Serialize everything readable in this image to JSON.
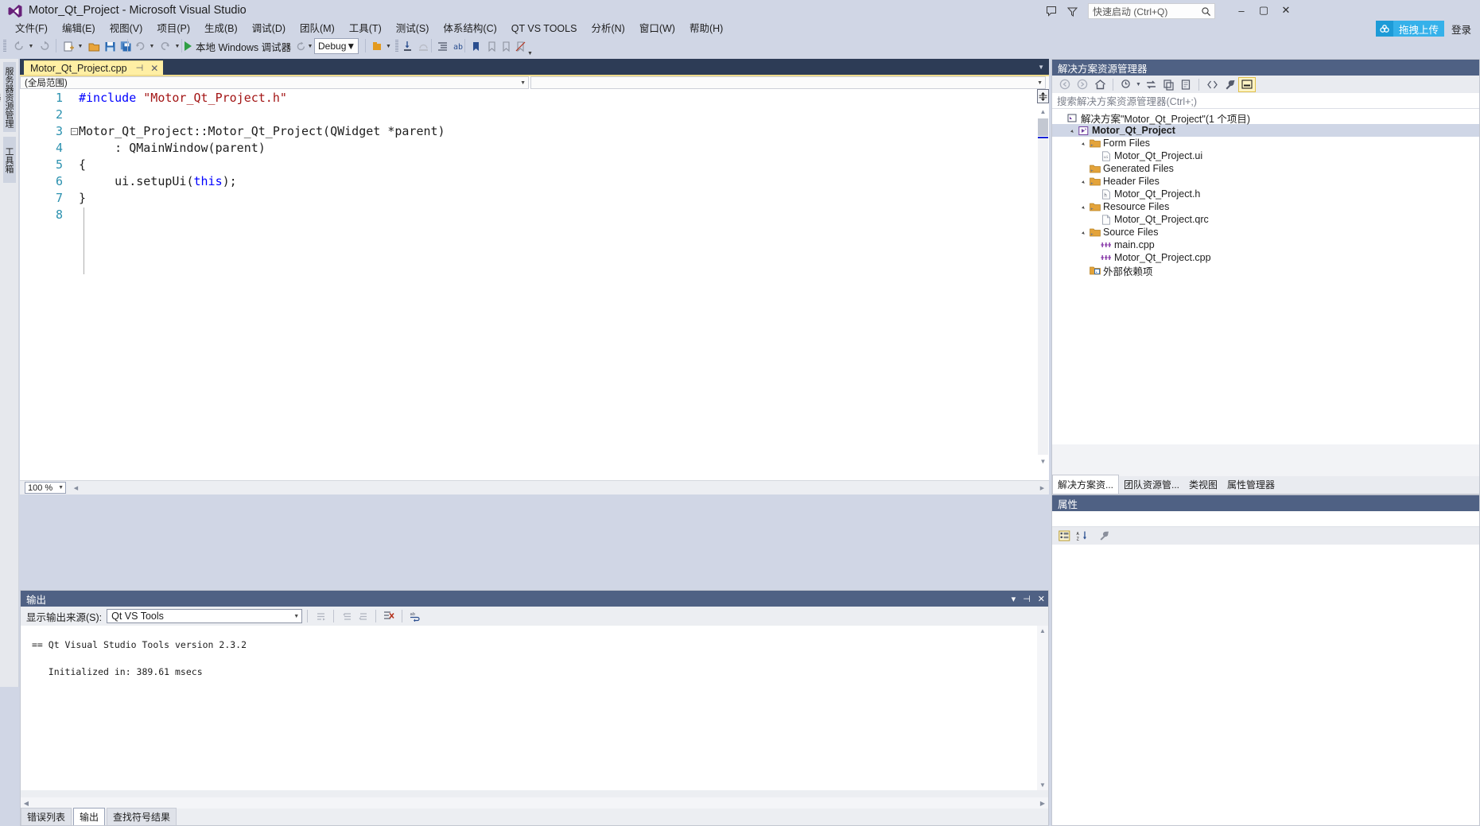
{
  "window": {
    "title": "Motor_Qt_Project - Microsoft Visual Studio",
    "logo_icon": "visual-studio-logo",
    "minimize": "–",
    "maximize": "▢",
    "close": "✕"
  },
  "titlebar": {
    "feedback_icon": "feedback-icon",
    "filter_icon": "filter-icon",
    "quick_launch_placeholder": "快速启动 (Ctrl+Q)",
    "search_icon": "search-icon"
  },
  "menu": {
    "items": [
      "文件(F)",
      "编辑(E)",
      "视图(V)",
      "项目(P)",
      "生成(B)",
      "调试(D)",
      "团队(M)",
      "工具(T)",
      "测试(S)",
      "体系结构(C)",
      "QT VS TOOLS",
      "分析(N)",
      "窗口(W)",
      "帮助(H)"
    ],
    "upload_label": "拖拽上传",
    "upload_icon": "cloud-upload-icon",
    "signin_label": "登录"
  },
  "toolbar": {
    "back_icon": "navigate-back-icon",
    "forward_icon": "navigate-forward-icon",
    "new_project_icon": "new-project-icon",
    "open_icon": "open-file-icon",
    "save_icon": "save-icon",
    "save_all_icon": "save-all-icon",
    "undo_icon": "undo-icon",
    "redo_icon": "redo-icon",
    "run_label": "本地 Windows 调试器",
    "run_icon": "play-icon",
    "refresh_icon": "restart-icon",
    "config_value": "Debug",
    "dropdown_icon": "chevron-down-icon"
  },
  "left_rail": {
    "tabs": [
      "服务器资源管理器",
      "工具箱"
    ]
  },
  "editor": {
    "tab_name": "Motor_Qt_Project.cpp",
    "pin_icon": "pin-icon",
    "close_icon": "close-icon",
    "tabstrip_dropdown_icon": "chevron-down-icon",
    "scope_dropdown": "(全局范围)",
    "member_dropdown": "",
    "zoom_level": "100 %",
    "map_icon": "scroll-map-icon",
    "code_lines": [
      {
        "n": "1",
        "fold": "",
        "parts": [
          {
            "t": "#include ",
            "c": "k-pre"
          },
          {
            "t": "\"Motor_Qt_Project.h\"",
            "c": "k-str"
          }
        ]
      },
      {
        "n": "2",
        "fold": "",
        "parts": [
          {
            "t": "",
            "c": ""
          }
        ]
      },
      {
        "n": "3",
        "fold": "−",
        "parts": [
          {
            "t": "Motor_Qt_Project::Motor_Qt_Project(QWidget *parent)",
            "c": ""
          }
        ]
      },
      {
        "n": "4",
        "fold": "",
        "parts": [
          {
            "t": "     : QMainWindow(parent)",
            "c": ""
          }
        ]
      },
      {
        "n": "5",
        "fold": "",
        "parts": [
          {
            "t": "{",
            "c": ""
          }
        ]
      },
      {
        "n": "6",
        "fold": "",
        "parts": [
          {
            "t": "     ui.setupUi(",
            "c": ""
          },
          {
            "t": "this",
            "c": "k-kw"
          },
          {
            "t": ");",
            "c": ""
          }
        ]
      },
      {
        "n": "7",
        "fold": "",
        "parts": [
          {
            "t": "}",
            "c": ""
          }
        ]
      },
      {
        "n": "8",
        "fold": "",
        "parts": [
          {
            "t": "",
            "c": ""
          }
        ]
      }
    ]
  },
  "output": {
    "title": "输出",
    "dropdown_icon": "chevron-down-icon",
    "pin_icon": "pin-icon",
    "close_icon": "close-icon",
    "source_label": "显示输出来源(S):",
    "source_value": "Qt VS Tools",
    "btn_goto_icon": "goto-message-icon",
    "btn_prev_icon": "previous-message-icon",
    "btn_next_icon": "next-message-icon",
    "btn_clear_icon": "clear-all-icon",
    "btn_wrap_icon": "toggle-word-wrap-icon",
    "lines": [
      "",
      "== Qt Visual Studio Tools version 2.3.2",
      "",
      "   Initialized in: 389.61 msecs"
    ],
    "bottom_tabs": [
      "错误列表",
      "输出",
      "查找符号结果"
    ],
    "bottom_tab_selected": "输出"
  },
  "solution_explorer": {
    "title": "解决方案资源管理器",
    "search_placeholder": "搜索解决方案资源管理器(Ctrl+;)",
    "toolbar_icons": [
      "back-icon",
      "forward-icon",
      "home-icon",
      "pending-changes-filter-icon",
      "sync-with-active-document-icon",
      "refresh-icon",
      "collapse-all-icon",
      "show-all-files-icon",
      "properties-icon",
      "preview-selected-items-icon"
    ],
    "tree": [
      {
        "indent": 0,
        "arrow": "",
        "icon": "solution-icon",
        "label": "解决方案\"Motor_Qt_Project\"(1 个项目)",
        "selected": false
      },
      {
        "indent": 1,
        "arrow": "▲",
        "icon": "project-icon",
        "label": "Motor_Qt_Project",
        "selected": true
      },
      {
        "indent": 2,
        "arrow": "▲",
        "icon": "folder-icon",
        "label": "Form Files",
        "selected": false
      },
      {
        "indent": 3,
        "arrow": "",
        "icon": "ui-file-icon",
        "label": "Motor_Qt_Project.ui",
        "selected": false
      },
      {
        "indent": 2,
        "arrow": "",
        "icon": "folder-icon",
        "label": "Generated Files",
        "selected": false
      },
      {
        "indent": 2,
        "arrow": "▲",
        "icon": "folder-icon",
        "label": "Header Files",
        "selected": false
      },
      {
        "indent": 3,
        "arrow": "",
        "icon": "header-file-icon",
        "label": "Motor_Qt_Project.h",
        "selected": false
      },
      {
        "indent": 2,
        "arrow": "▲",
        "icon": "folder-icon",
        "label": "Resource Files",
        "selected": false
      },
      {
        "indent": 3,
        "arrow": "",
        "icon": "qrc-file-icon",
        "label": "Motor_Qt_Project.qrc",
        "selected": false
      },
      {
        "indent": 2,
        "arrow": "▲",
        "icon": "folder-icon",
        "label": "Source Files",
        "selected": false
      },
      {
        "indent": 3,
        "arrow": "",
        "icon": "cpp-file-icon",
        "label": "main.cpp",
        "selected": false
      },
      {
        "indent": 3,
        "arrow": "",
        "icon": "cpp-file-icon",
        "label": "Motor_Qt_Project.cpp",
        "selected": false
      },
      {
        "indent": 2,
        "arrow": "",
        "icon": "external-deps-icon",
        "label": "外部依赖项",
        "selected": false
      }
    ],
    "tabs": [
      "解决方案资...",
      "团队资源管...",
      "类视图",
      "属性管理器"
    ],
    "tab_selected": "解决方案资..."
  },
  "properties": {
    "title": "属性",
    "categorized_icon": "categorized-view-icon",
    "alphabetical_icon": "alphabetical-sort-icon",
    "property_pages_icon": "property-pages-icon"
  },
  "colors": {
    "chrome": "#d0d6e5",
    "panel_header": "#4f6184",
    "editor_tabstrip": "#2d3c56",
    "tab_active": "#ffefa4",
    "accent_blue": "#35b1ea",
    "line_number": "#2b91af",
    "preprocessor": "#0000ff",
    "string": "#a31515"
  }
}
